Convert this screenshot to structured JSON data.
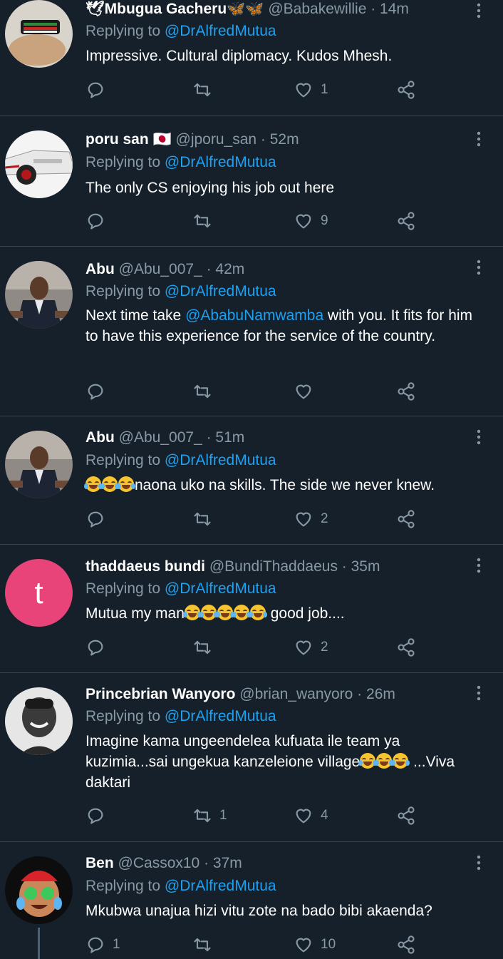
{
  "tweets": [
    {
      "name": "🕊Mbugua Gacheru🦋🦋",
      "handle": "@Babakewillie · 14m",
      "replying_prefix": "Replying to ",
      "replying_to": "@DrAlfredMutua",
      "text": "Impressive. Cultural diplomacy. Kudos Mhesh.",
      "replies": "",
      "retweets": "",
      "likes": "1",
      "avatar": "bracelet-photo"
    },
    {
      "name": "poru san 🇯🇵",
      "handle": "@jporu_san · 52m",
      "replying_prefix": "Replying to ",
      "replying_to": "@DrAlfredMutua",
      "text": "The only CS enjoying his job out here",
      "replies": "",
      "retweets": "",
      "likes": "9",
      "avatar": "car-photo"
    },
    {
      "name": "Abu",
      "handle": "@Abu_007_ · 42m",
      "replying_prefix": "Replying to ",
      "replying_to": "@DrAlfredMutua",
      "text_pre": "Next time take ",
      "text_mention": "@AbabuNamwamba",
      "text_post": " with you. It fits for him to have this experience for the service of the country.",
      "replies": "",
      "retweets": "",
      "likes": "",
      "avatar": "man-suit-photo"
    },
    {
      "name": "Abu",
      "handle": "@Abu_007_ · 51m",
      "replying_prefix": "Replying to ",
      "replying_to": "@DrAlfredMutua",
      "text_emoji": "😂😂😂",
      "text": "naona uko na skills. The side we never knew.",
      "replies": "",
      "retweets": "",
      "likes": "2",
      "avatar": "man-suit-photo"
    },
    {
      "name": "thaddaeus bundi",
      "handle": "@BundiThaddaeus · 35m",
      "replying_prefix": "Replying to ",
      "replying_to": "@DrAlfredMutua",
      "text_pre": "Mutua my man",
      "text_emoji": "🤣🤣🤣🤣🤣",
      "text_post": " good job....",
      "replies": "",
      "retweets": "",
      "likes": "2",
      "avatar_letter": "t",
      "avatar_color": "#e8447a"
    },
    {
      "name": "Princebrian Wanyoro",
      "handle": "@brian_wanyoro · 26m",
      "replying_prefix": "Replying to ",
      "replying_to": "@DrAlfredMutua",
      "text_pre": "Imagine kama ungeendelea kufuata ile team ya kuzimia...sai ungekua kanzeleione village",
      "text_emoji": "🤣🤣🤣",
      "text_post": " ...Viva daktari",
      "replies": "",
      "retweets": "1",
      "likes": "4",
      "avatar": "man-smiling-bw-photo"
    },
    {
      "name": "Ben",
      "handle": "@Cassox10 · 37m",
      "replying_prefix": "Replying to ",
      "replying_to": "@DrAlfredMutua",
      "text": "Mkubwa unajua hizi vitu zote na bado bibi akaenda?",
      "replies": "1",
      "retweets": "",
      "likes": "10",
      "avatar": "laughing-emoji-avatar"
    }
  ],
  "colors": {
    "background": "#15202b",
    "divider": "#38444d",
    "secondary_text": "#8899a6",
    "link": "#1da1f2"
  }
}
